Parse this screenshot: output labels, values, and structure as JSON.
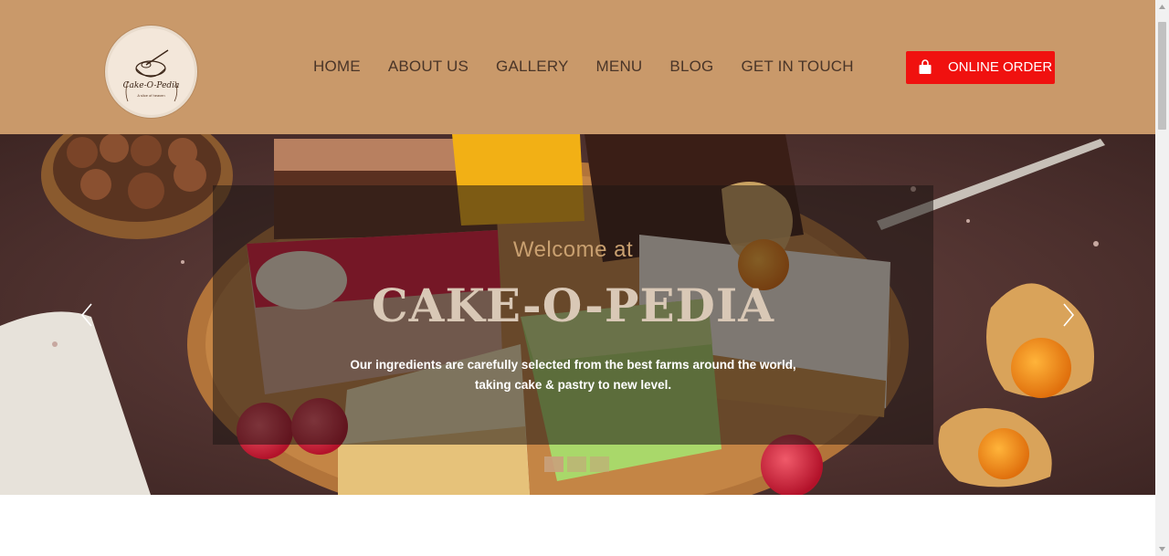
{
  "header": {
    "logo": {
      "name": "Cake-O-Pedia",
      "tagline": "A slice of heaven"
    },
    "nav": [
      "HOME",
      "ABOUT US",
      "GALLERY",
      "MENU",
      "BLOG",
      "GET IN TOUCH"
    ],
    "order_button": {
      "label": "ONLINE ORDER",
      "icon": "shopping-bag-icon"
    }
  },
  "hero": {
    "welcome": "Welcome at",
    "title": "CAKE-O-PEDIA",
    "tagline_line1": "Our ingredients are carefully selected from the best farms around the world,",
    "tagline_line2": "taking cake & pastry to new level.",
    "slide_count": 3,
    "active_slide": 1
  },
  "colors": {
    "header_bg": "#c9996a",
    "accent_red": "#f0110f",
    "welcome_gold": "#c9a070"
  }
}
